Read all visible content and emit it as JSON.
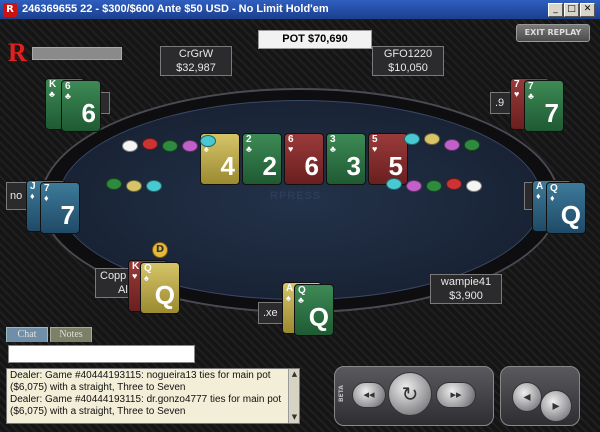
{
  "window": {
    "title": "246369655 22 - $300/$600 Ante $50 USD - No Limit Hold'em",
    "minimize_glyph": "_",
    "maximize_glyph": "□",
    "close_glyph": "✕"
  },
  "table": {
    "logo_letter": "R",
    "exit_button": "EXIT REPLAY",
    "pot_label": "POT $70,690",
    "felt_logo": "RPRESS"
  },
  "players": [
    {
      "name": "CrGrW",
      "stack": "$32,987"
    },
    {
      "name": "GFO1220",
      "stack": "$10,050"
    },
    {
      "name": "wampie41",
      "stack": "$3,900"
    },
    {
      "name": "Copp",
      "stack": "Al"
    },
    {
      "name": "no",
      "stack": ""
    },
    {
      "name": ".xe",
      "stack": ""
    },
    {
      "name": ".9",
      "stack": ""
    },
    {
      "name": "",
      "stack": ""
    }
  ],
  "board": [
    {
      "rank": "4",
      "suit": "♠",
      "color": "gold"
    },
    {
      "rank": "2",
      "suit": "♣",
      "color": "green"
    },
    {
      "rank": "6",
      "suit": "♥",
      "color": "red"
    },
    {
      "rank": "3",
      "suit": "♣",
      "color": "green"
    },
    {
      "rank": "5",
      "suit": "♥",
      "color": "red"
    }
  ],
  "hands": {
    "top_left": [
      {
        "rank": "K",
        "suit": "♣"
      },
      {
        "rank": "6",
        "suit": "♣"
      }
    ],
    "left": [
      {
        "rank": "J",
        "suit": "♦"
      },
      {
        "rank": "7",
        "suit": "♦"
      }
    ],
    "bottom_left": [
      {
        "rank": "K",
        "suit": "♥"
      },
      {
        "rank": "Q",
        "suit": "♠"
      }
    ],
    "bottom": [
      {
        "rank": "A",
        "suit": "♠"
      },
      {
        "rank": "Q",
        "suit": "♣"
      }
    ],
    "right": [
      {
        "rank": "A",
        "suit": "♦"
      },
      {
        "rank": "Q",
        "suit": "♦"
      }
    ],
    "top_right": [
      {
        "rank": "7",
        "suit": "♥"
      },
      {
        "rank": "7",
        "suit": "♣"
      }
    ]
  },
  "dealer_button": "D",
  "chat": {
    "tab_chat": "Chat",
    "tab_notes": "Notes",
    "input_value": "",
    "lines": [
      "Dealer: Game #40444193115: nogueira13 ties for main pot",
      "  ($6,075) with a straight, Three to Seven",
      "Dealer: Game #40444193115: dr.gonzo4777 ties for main pot",
      "  ($6,075) with a straight, Three to Seven"
    ],
    "scroll_up": "▲",
    "scroll_down": "▼"
  },
  "replay": {
    "beta": "BETA",
    "rewind": "◂◂",
    "play": "↻",
    "forward": "▸▸",
    "prev": "◂",
    "next": "▸"
  },
  "colors": {
    "green_card": "#2f7a48",
    "red_card": "#8a2e2e",
    "blue_card": "#2f6a8a",
    "gold_card": "#c8b452",
    "felt": "#1c283c"
  }
}
